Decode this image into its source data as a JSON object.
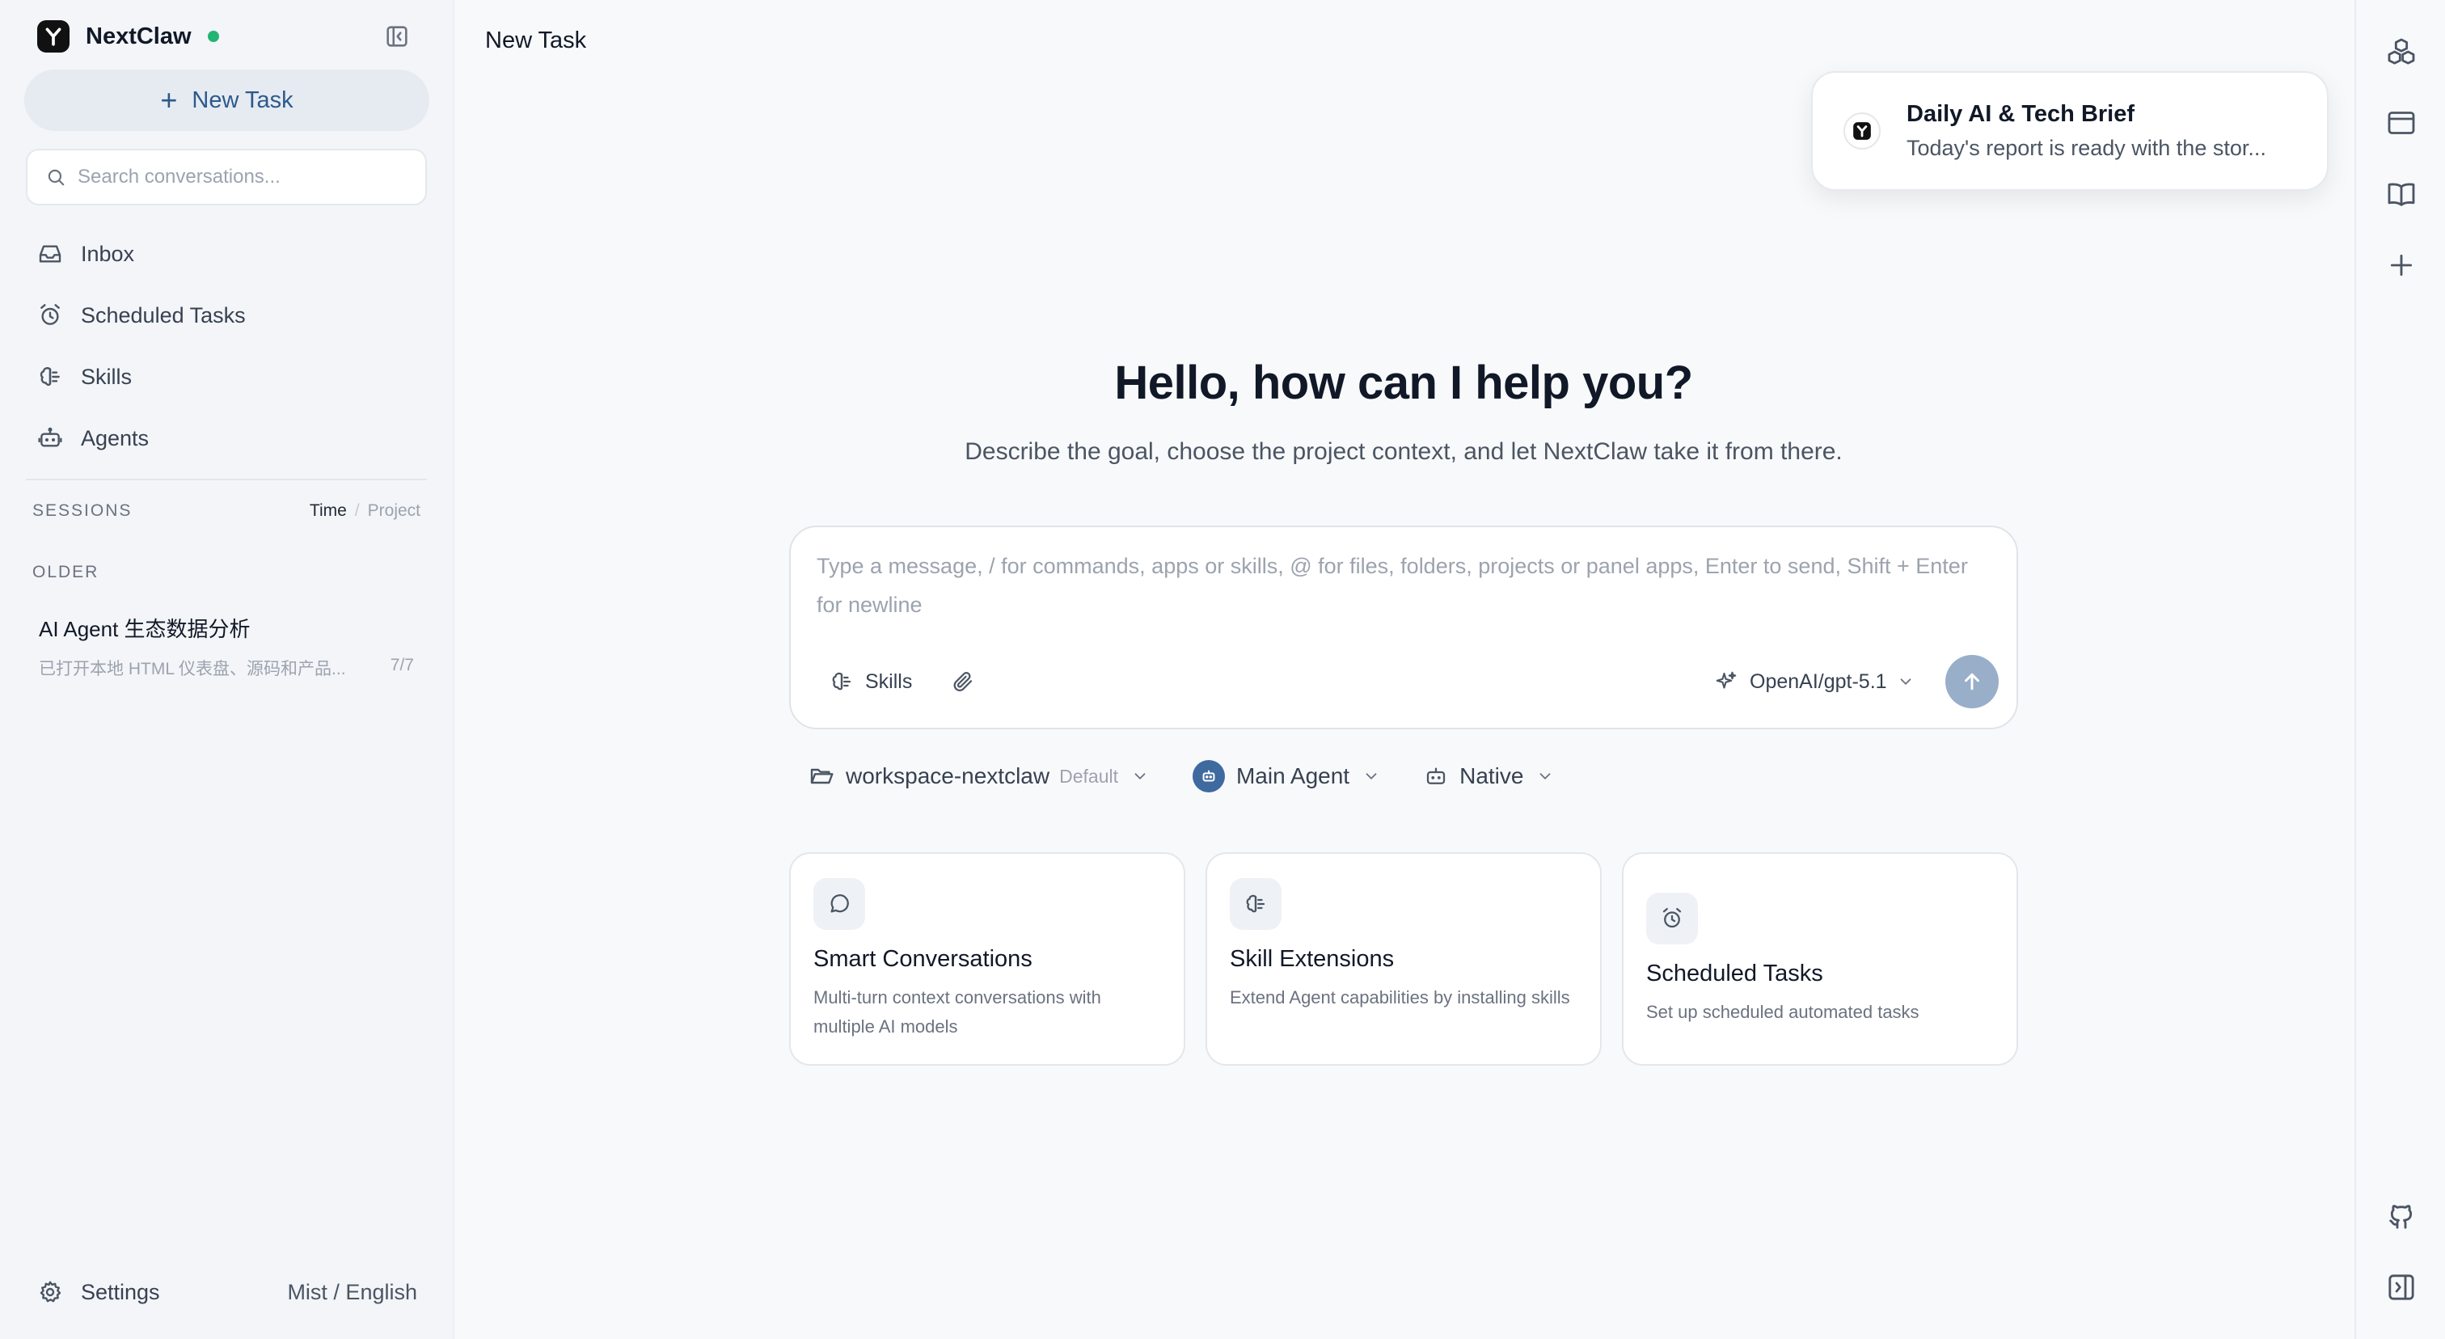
{
  "sidebar": {
    "app_name": "NextClaw",
    "new_task_label": "New Task",
    "search_placeholder": "Search conversations...",
    "nav": [
      {
        "label": "Inbox",
        "icon": "inbox-icon"
      },
      {
        "label": "Scheduled Tasks",
        "icon": "alarm-clock-icon"
      },
      {
        "label": "Skills",
        "icon": "brain-icon"
      },
      {
        "label": "Agents",
        "icon": "bot-icon"
      }
    ],
    "sessions_label": "SESSIONS",
    "sort_time": "Time",
    "sort_sep": "/",
    "sort_project": "Project",
    "older_label": "OLDER",
    "session": {
      "title": "AI Agent 生态数据分析",
      "preview": "已打开本地 HTML 仪表盘、源码和产品...",
      "count": "7/7"
    },
    "settings_label": "Settings",
    "theme_language": "Mist / English"
  },
  "main": {
    "title": "New Task",
    "hero_title": "Hello, how can I help you?",
    "hero_subtitle": "Describe the goal, choose the project context, and let NextClaw take it from there.",
    "composer": {
      "placeholder": "Type a message, / for commands, apps or skills, @ for files, folders, projects or panel apps, Enter to send, Shift + Enter for newline",
      "skills_label": "Skills",
      "model_label": "OpenAI/gpt-5.1"
    },
    "context": {
      "workspace": "workspace-nextclaw",
      "workspace_tag": "Default",
      "agent": "Main Agent",
      "runtime": "Native"
    },
    "cards": [
      {
        "title": "Smart Conversations",
        "desc": "Multi-turn context conversations with multiple AI models",
        "icon": "chat-bubble-icon"
      },
      {
        "title": "Skill Extensions",
        "desc": "Extend Agent capabilities by installing skills",
        "icon": "brain-icon"
      },
      {
        "title": "Scheduled Tasks",
        "desc": "Set up scheduled automated tasks",
        "icon": "alarm-clock-icon"
      }
    ]
  },
  "toast": {
    "title": "Daily AI & Tech Brief",
    "body": "Today's report is ready with the stor..."
  },
  "rail": {
    "icons": [
      "boxes-icon",
      "browser-window-icon",
      "book-open-icon",
      "plus-icon",
      "github-icon",
      "panel-right-icon"
    ]
  },
  "colors": {
    "accent": "#2d5a8a",
    "status_online": "#22b573",
    "send_button": "#98aec9",
    "agent_avatar": "#3f6aa0"
  }
}
